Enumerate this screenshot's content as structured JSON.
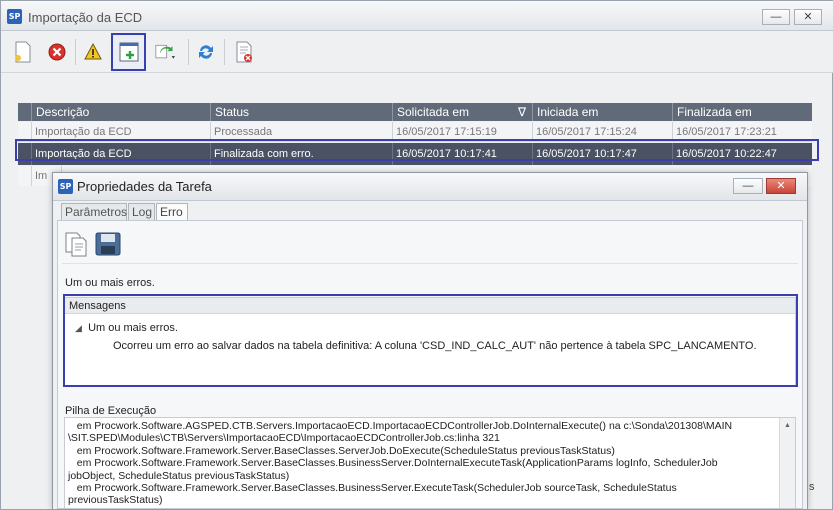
{
  "window": {
    "app_icon": "SP",
    "title": "Importação da ECD",
    "minimize_label": "—",
    "restore_label": "❐",
    "close_label": "✕"
  },
  "toolbar": {
    "icons": [
      "new-icon",
      "delete-icon",
      "warning-icon",
      "add-task-icon",
      "export-dropdown-icon",
      "refresh-icon",
      "delete-document-icon"
    ]
  },
  "grid": {
    "columns": [
      "Descrição",
      "Status",
      "Solicitada em",
      "Iniciada em",
      "Finalizada em"
    ],
    "sort_indicator": "∇",
    "rows": [
      {
        "descricao": "Importação da ECD",
        "status": "Processada",
        "solicitada": "16/05/2017 17:15:19",
        "iniciada": "16/05/2017 17:15:24",
        "finalizada": "16/05/2017 17:23:21"
      },
      {
        "descricao": "Importação da ECD",
        "status": "Finalizada com erro.",
        "solicitada": "16/05/2017 10:17:41",
        "iniciada": "16/05/2017 10:17:47",
        "finalizada": "16/05/2017 10:22:47"
      },
      {
        "descricao": "Im",
        "status": "",
        "solicitada": "",
        "iniciada": "",
        "finalizada": ""
      }
    ]
  },
  "dialog": {
    "app_icon": "SP",
    "title": "Propriedades da Tarefa",
    "minimize_label": "—",
    "close_label": "✕",
    "tabs": [
      "Parâmetros",
      "Log",
      "Erro"
    ],
    "status_text": "Um ou mais erros.",
    "messages_header": "Mensagens",
    "message_item": "Um ou mais erros.",
    "message_detail": "Ocorreu um erro ao salvar dados na tabela definitiva: A coluna 'CSD_IND_CALC_AUT' não pertence à tabela SPC_LANCAMENTO.",
    "stack_label": "Pilha de Execução",
    "stack_text": "   em Procwork.Software.AGSPED.CTB.Servers.ImportacaoECD.ImportacaoECDControllerJob.DoInternalExecute() na c:\\Sonda\\201308\\MAIN\n\\SIT.SPED\\Modules\\CTB\\Servers\\ImportacaoECD\\ImportacaoECDControllerJob.cs:linha 321\n   em Procwork.Software.Framework.Server.BaseClasses.ServerJob.DoExecute(ScheduleStatus previousTaskStatus)\n   em Procwork.Software.Framework.Server.BaseClasses.BusinessServer.DoInternalExecuteTask(ApplicationParams logInfo, SchedulerJob\njobObject, ScheduleStatus previousTaskStatus)\n   em Procwork.Software.Framework.Server.BaseClasses.BusinessServer.ExecuteTask(SchedulerJob sourceTask, ScheduleStatus\npreviousTaskStatus)"
  },
  "background_fragment": "s",
  "colors": {
    "grid_header": "#616a78",
    "selected_row": "#4a5263",
    "highlight_border": "#3a3fb0"
  }
}
